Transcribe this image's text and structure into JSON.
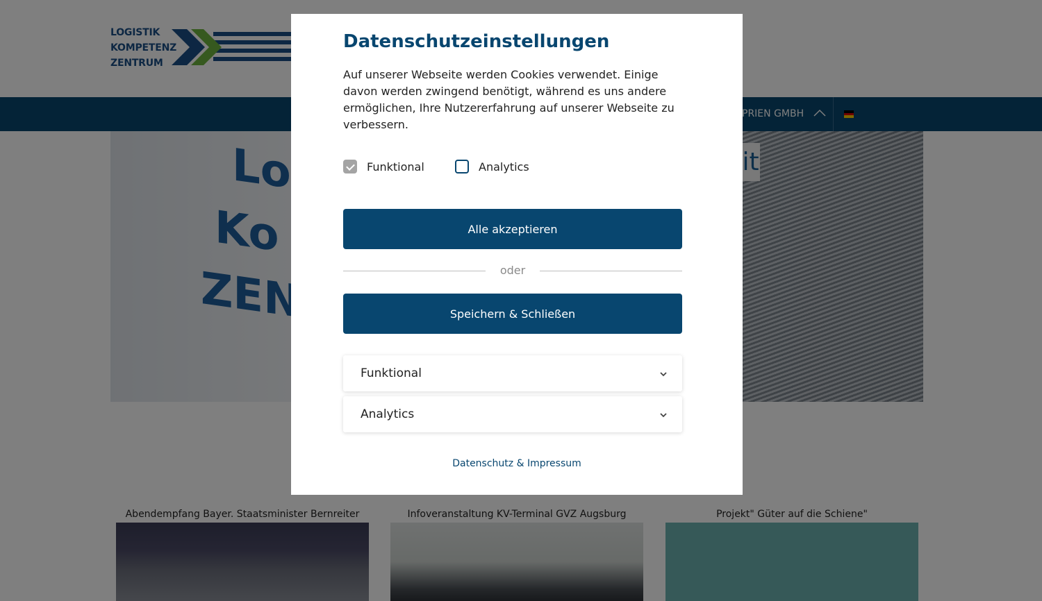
{
  "header": {
    "logo_lines": [
      "LOGISTIK",
      "KOMPETENZ",
      "ZENTRUM"
    ],
    "nav_item": "PRIEN GMBH",
    "language": "DE"
  },
  "hero": {
    "letters": [
      "Lo",
      "Ko",
      "ZEN"
    ],
    "caption": "it"
  },
  "news": [
    {
      "title": "Abendempfang Bayer. Staatsminister Bernreiter"
    },
    {
      "title": "Infoveranstaltung KV-Terminal GVZ Augsburg"
    },
    {
      "title": "Projekt\" Güter auf die Schiene\""
    }
  ],
  "modal": {
    "title": "Datenschutzeinstellungen",
    "text": "Auf unserer Webseite werden Cookies verwendet. Einige davon werden zwingend benötigt, während es uns andere ermöglichen, Ihre Nutzererfahrung auf unserer Webseite zu verbessern.",
    "checkboxes": [
      {
        "label": "Funktional",
        "checked": true,
        "disabled": true
      },
      {
        "label": "Analytics",
        "checked": false,
        "disabled": false
      }
    ],
    "accept_all": "Alle akzeptieren",
    "or": "oder",
    "save_close": "Speichern & Schließen",
    "sections": [
      {
        "label": "Funktional"
      },
      {
        "label": "Analytics"
      }
    ],
    "privacy_link": "Datenschutz & Impressum"
  },
  "colors": {
    "primary": "#08466f",
    "overlay": "rgba(0,0,0,0.5)"
  }
}
